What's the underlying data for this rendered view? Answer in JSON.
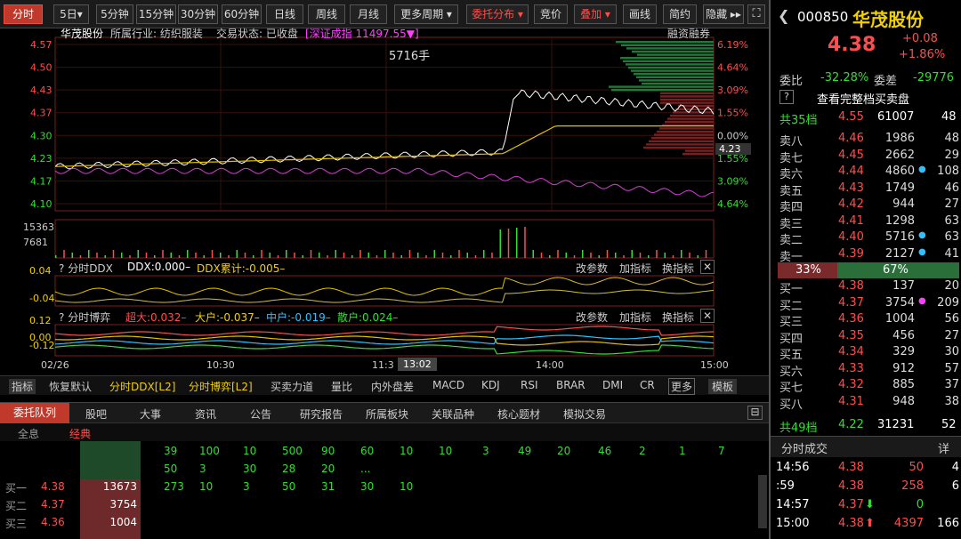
{
  "toolbar": {
    "items": [
      "分时",
      "5日▾",
      "5分钟",
      "15分钟",
      "30分钟",
      "60分钟",
      "日线",
      "周线",
      "月线",
      "更多周期 ▾",
      "委托分布 ▾",
      "竞价",
      "叠加 ▾",
      "画线",
      "简约",
      "隐藏 ▸▸"
    ],
    "expand_icon": "expand-icon"
  },
  "chart": {
    "stock": "华茂股份",
    "industry": "所属行业: 纺织服装",
    "status": "交易状态: 已收盘",
    "index": "[深证成指 11497.55▼]",
    "margin": "融资融券",
    "vol_note": "5716手",
    "price_ticks": [
      "4.57",
      "4.50",
      "4.43",
      "4.37",
      "4.30",
      "4.23",
      "4.17",
      "4.10"
    ],
    "pct_ticks": [
      "6.19%",
      "4.64%",
      "3.09%",
      "1.55%",
      "0.00%",
      "1.55%",
      "3.09%",
      "4.64%"
    ],
    "cur_price": "4.23",
    "vol_ticks": [
      "15363",
      "7681"
    ],
    "ddx": {
      "title": "分时DDX",
      "ddx": "DDX:0.000–",
      "cum": "DDX累计:-0.005–",
      "ticks": [
        "0.04",
        "-0.04"
      ],
      "actions": [
        "改参数",
        "加指标",
        "换指标",
        "✕"
      ]
    },
    "game": {
      "title": "分时博弈",
      "super": "超大:0.032–",
      "big": "大户:-0.037–",
      "mid": "中户:-0.019–",
      "small": "散户:0.024–",
      "ticks": [
        "0.12",
        "0.00",
        "-0.12"
      ],
      "actions": [
        "改参数",
        "加指标",
        "换指标",
        "✕"
      ]
    },
    "times": [
      "02/26",
      "10:30",
      "11:3",
      "13:02",
      "14:00",
      "15:00"
    ]
  },
  "chart_data": {
    "type": "line",
    "x": [
      "09:30",
      "10:30",
      "11:30/13:00",
      "14:00",
      "15:00"
    ],
    "series": [
      {
        "name": "price",
        "values": [
          4.22,
          4.26,
          4.26,
          4.4,
          4.38
        ]
      },
      {
        "name": "avg",
        "values": [
          4.22,
          4.23,
          4.24,
          4.31,
          4.33
        ]
      }
    ],
    "ylim": [
      4.1,
      4.57
    ],
    "prev_close": 4.3
  },
  "indicator_bar": [
    "指标",
    "恢复默认",
    "分时DDX[L2]",
    "分时博弈[L2]",
    "买卖力道",
    "量比",
    "内外盘差",
    "MACD",
    "KDJ",
    "RSI",
    "BRAR",
    "DMI",
    "CR",
    "更多",
    "模板"
  ],
  "tabs": [
    "委托队列",
    "股吧",
    "大事",
    "资讯",
    "公告",
    "研究报告",
    "所属板块",
    "关联品种",
    "核心题材",
    "模拟交易"
  ],
  "subtabs": [
    "全息",
    "经典"
  ],
  "queue": {
    "row1": [
      "39",
      "100",
      "10",
      "500",
      "90",
      "60",
      "10",
      "10",
      "3",
      "49",
      "20",
      "46",
      "2",
      "1",
      "7"
    ],
    "row2": [
      "50",
      "3",
      "30",
      "28",
      "20",
      "..."
    ],
    "row3": [
      "273",
      "10",
      "3",
      "50",
      "31",
      "30",
      "10"
    ],
    "bids": [
      {
        "label": "买一",
        "price": "4.38",
        "vol": "13673"
      },
      {
        "label": "买二",
        "price": "4.37",
        "vol": "3754"
      },
      {
        "label": "买三",
        "price": "4.36",
        "vol": "1004"
      }
    ]
  },
  "quote": {
    "code": "000850",
    "name": "华茂股份",
    "price": "4.38",
    "chg": "+0.08",
    "pct": "+1.86%",
    "wb_label": "委比",
    "wb": "-32.28%",
    "wc_label": "委差",
    "wc": "-29776",
    "full_book": "查看完整档买卖盘",
    "ask_total": {
      "label": "共35档",
      "price": "4.55",
      "vol": "61007",
      "cnt": "48"
    },
    "asks": [
      {
        "l": "卖八",
        "p": "4.46",
        "q": "1986",
        "c": "48",
        "d": ""
      },
      {
        "l": "卖七",
        "p": "4.45",
        "q": "2662",
        "c": "29",
        "d": ""
      },
      {
        "l": "卖六",
        "p": "4.44",
        "q": "4860",
        "c": "108",
        "d": "cyan"
      },
      {
        "l": "卖五",
        "p": "4.43",
        "q": "1749",
        "c": "46",
        "d": ""
      },
      {
        "l": "卖四",
        "p": "4.42",
        "q": "944",
        "c": "27",
        "d": ""
      },
      {
        "l": "卖三",
        "p": "4.41",
        "q": "1298",
        "c": "63",
        "d": ""
      },
      {
        "l": "卖二",
        "p": "4.40",
        "q": "5716",
        "c": "63",
        "d": "cyan"
      },
      {
        "l": "卖一",
        "p": "4.39",
        "q": "2127",
        "c": "41",
        "d": "cyan"
      }
    ],
    "ratio": {
      "buy": "33%",
      "sell": "67%",
      "buy_fraction": 0.33
    },
    "bids": [
      {
        "l": "买一",
        "p": "4.38",
        "q": "137",
        "c": "20",
        "d": ""
      },
      {
        "l": "买二",
        "p": "4.37",
        "q": "3754",
        "c": "209",
        "d": "magenta"
      },
      {
        "l": "买三",
        "p": "4.36",
        "q": "1004",
        "c": "56",
        "d": ""
      },
      {
        "l": "买四",
        "p": "4.35",
        "q": "456",
        "c": "27",
        "d": ""
      },
      {
        "l": "买五",
        "p": "4.34",
        "q": "329",
        "c": "30",
        "d": ""
      },
      {
        "l": "买六",
        "p": "4.33",
        "q": "912",
        "c": "57",
        "d": ""
      },
      {
        "l": "买七",
        "p": "4.32",
        "q": "885",
        "c": "37",
        "d": ""
      },
      {
        "l": "买八",
        "p": "4.31",
        "q": "948",
        "c": "38",
        "d": ""
      }
    ],
    "bid_total": {
      "label": "共49档",
      "price": "4.22",
      "vol": "31231",
      "cnt": "52"
    },
    "trades_title": "分时成交",
    "trades_detail": "详",
    "trades": [
      {
        "t": "14:56",
        "p": "4.38",
        "q": "50",
        "c": "4",
        "a": ""
      },
      {
        "t": ":59",
        "p": "4.38",
        "q": "258",
        "c": "6",
        "a": ""
      },
      {
        "t": "14:57",
        "p": "4.37",
        "q": "0",
        "c": "",
        "a": "⬇"
      },
      {
        "t": "15:00",
        "p": "4.38",
        "q": "4397",
        "c": "166",
        "a": "⬆"
      }
    ]
  }
}
